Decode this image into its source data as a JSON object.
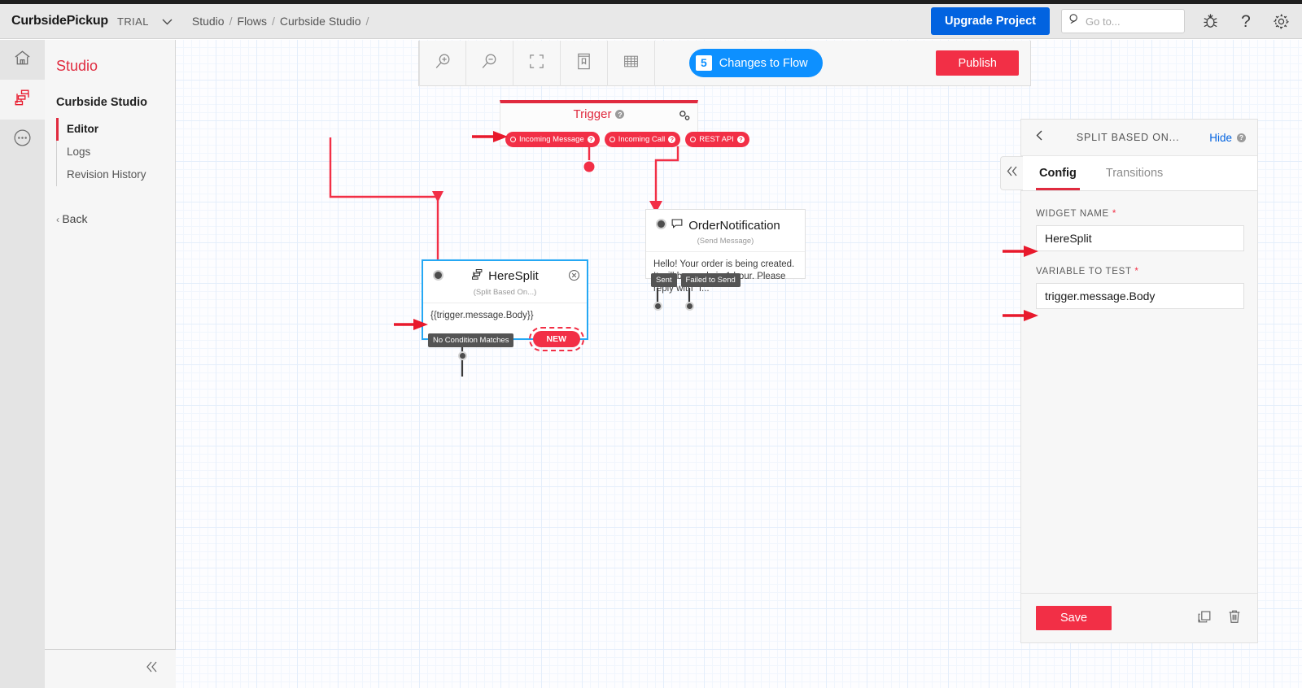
{
  "header": {
    "brand": "CurbsidePickup",
    "plan": "TRIAL",
    "dropdown_icon": "chevron-down-icon",
    "breadcrumbs": [
      "Studio",
      "/",
      "Flows",
      "/",
      "Curbside Studio",
      "/"
    ],
    "upgrade_label": "Upgrade Project",
    "search_placeholder": "Go to...",
    "search_value": "",
    "icons": [
      "search-icon",
      "bug-icon",
      "help-icon",
      "settings-gear-icon"
    ]
  },
  "rail": {
    "items": [
      {
        "name": "home-icon",
        "active": false
      },
      {
        "name": "studio-flow-icon",
        "active": true
      },
      {
        "name": "more-ellipsis-icon",
        "active": false
      }
    ]
  },
  "sidebar": {
    "title": "Studio",
    "project": "Curbside Studio",
    "items": [
      {
        "label": "Editor",
        "selected": true
      },
      {
        "label": "Logs",
        "selected": false
      },
      {
        "label": "Revision History",
        "selected": false
      }
    ],
    "back_label": "Back",
    "collapse_icon": "double-chevron-left-icon"
  },
  "toolbar": {
    "buttons": [
      {
        "name": "zoom-in-icon"
      },
      {
        "name": "zoom-out-icon"
      },
      {
        "name": "fit-to-screen-icon"
      },
      {
        "name": "library-icon"
      },
      {
        "name": "grid-icon"
      }
    ],
    "changes_count": "5",
    "changes_label": "Changes to Flow",
    "publish_label": "Publish"
  },
  "flow": {
    "trigger": {
      "title": "Trigger",
      "gear_icon": "double-gear-icon",
      "transitions": [
        {
          "label": "Incoming Message"
        },
        {
          "label": "Incoming Call"
        },
        {
          "label": "REST API"
        }
      ]
    },
    "split_widget": {
      "name": "HereSplit",
      "type_icon": "split-icon",
      "subtitle": "(Split Based On...)",
      "expression": "{{trigger.message.Body}}",
      "outputs": [
        "No Condition Matches"
      ],
      "new_label": "NEW",
      "close_icon": "close-circle-icon",
      "selected": true
    },
    "send_widget": {
      "name": "OrderNotification",
      "type_icon": "message-bubble-icon",
      "subtitle": "(Send Message)",
      "body": "Hello! Your order is being created. It will be ready in 1 hour. Please reply with \"I...",
      "outputs": [
        "Sent",
        "Failed to Send"
      ]
    }
  },
  "panel": {
    "back_icon": "chevron-left-icon",
    "title": "SPLIT BASED ON...",
    "hide_label": "Hide",
    "help_icon": "help-circle-icon",
    "collapse_icon": "double-chevron-left-icon",
    "tabs": [
      {
        "label": "Config",
        "active": true
      },
      {
        "label": "Transitions",
        "active": false
      }
    ],
    "fields": [
      {
        "label": "WIDGET NAME",
        "required": "*",
        "value": "HereSplit"
      },
      {
        "label": "VARIABLE TO TEST",
        "required": "*",
        "value": "trigger.message.Body"
      }
    ],
    "save_label": "Save",
    "footer_icons": [
      "duplicate-icon",
      "delete-trash-icon"
    ]
  },
  "colors": {
    "brand_red": "#f22f46",
    "accent_blue": "#0d90ff",
    "upgrade_blue": "#0263e0",
    "selected_border": "#25a8f4",
    "annotation_red": "#e8192c"
  }
}
